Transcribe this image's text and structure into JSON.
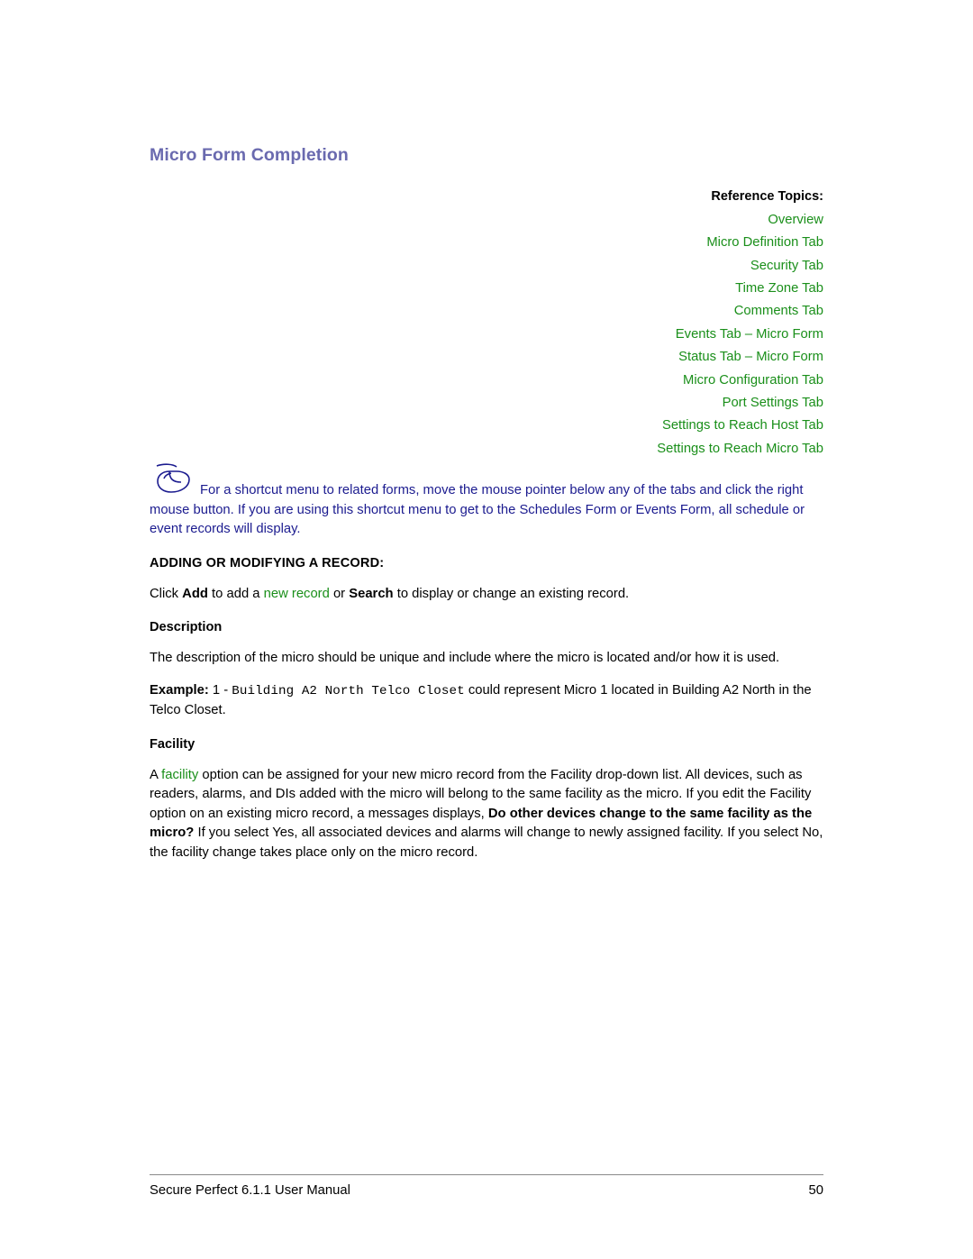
{
  "document": {
    "page_title": "Micro Form Completion"
  },
  "reference_topics": {
    "heading": "Reference Topics:",
    "links": [
      "Overview",
      "Micro Definition Tab",
      "Security Tab",
      "Time Zone Tab",
      "Comments Tab",
      "Events Tab – Micro Form",
      "Status Tab – Micro Form",
      "Micro Configuration Tab",
      "Port Settings Tab",
      "Settings to Reach Host Tab",
      "Settings to Reach Micro Tab"
    ]
  },
  "note": {
    "icon": "mouse-icon",
    "text": "For a shortcut menu to related forms, move the mouse pointer below any of the tabs and click the right mouse button. If you are using this shortcut menu to get to the Schedules Form or Events Form, all schedule or event records will display."
  },
  "sections": {
    "adding_heading": "ADDING OR MODIFYING A RECORD:",
    "add_para": {
      "part1": "Click ",
      "bold1": "Add",
      "part2": " to add a ",
      "link1": "new record",
      "part3": " or ",
      "bold2": "Search",
      "part4": " to display or change an existing record."
    },
    "description_heading": "Description",
    "description_para": "The description of the micro should be unique and include where the micro is located and/or how it is used.",
    "example_para": {
      "label": "Example:",
      "prefix": " 1 - ",
      "mono": "Building A2 North Telco Closet",
      "suffix": " could represent Micro 1 located in Building A2 North in the Telco Closet."
    },
    "facility_heading": "Facility",
    "facility_para": {
      "part1": "A ",
      "link1": "facility",
      "part2": " option can be assigned for your new micro record from the Facility drop-down list. All devices, such as readers, alarms, and DIs added with the micro will belong to the same facility as the micro. If you edit the Facility option on an existing micro record, a messages displays, ",
      "bold1": "Do other devices change to the same facility as the micro?",
      "part3": " If you select Yes, all associated devices and alarms will change to newly assigned facility. If you select No, the facility change takes place only on the micro record."
    }
  },
  "footer": {
    "left": "Secure Perfect 6.1.1 User Manual",
    "page_number": "50"
  },
  "colors": {
    "title": "#6a6aaf",
    "link_green": "#1a8f1a",
    "note_blue": "#1b1b8f",
    "body": "#000000"
  }
}
